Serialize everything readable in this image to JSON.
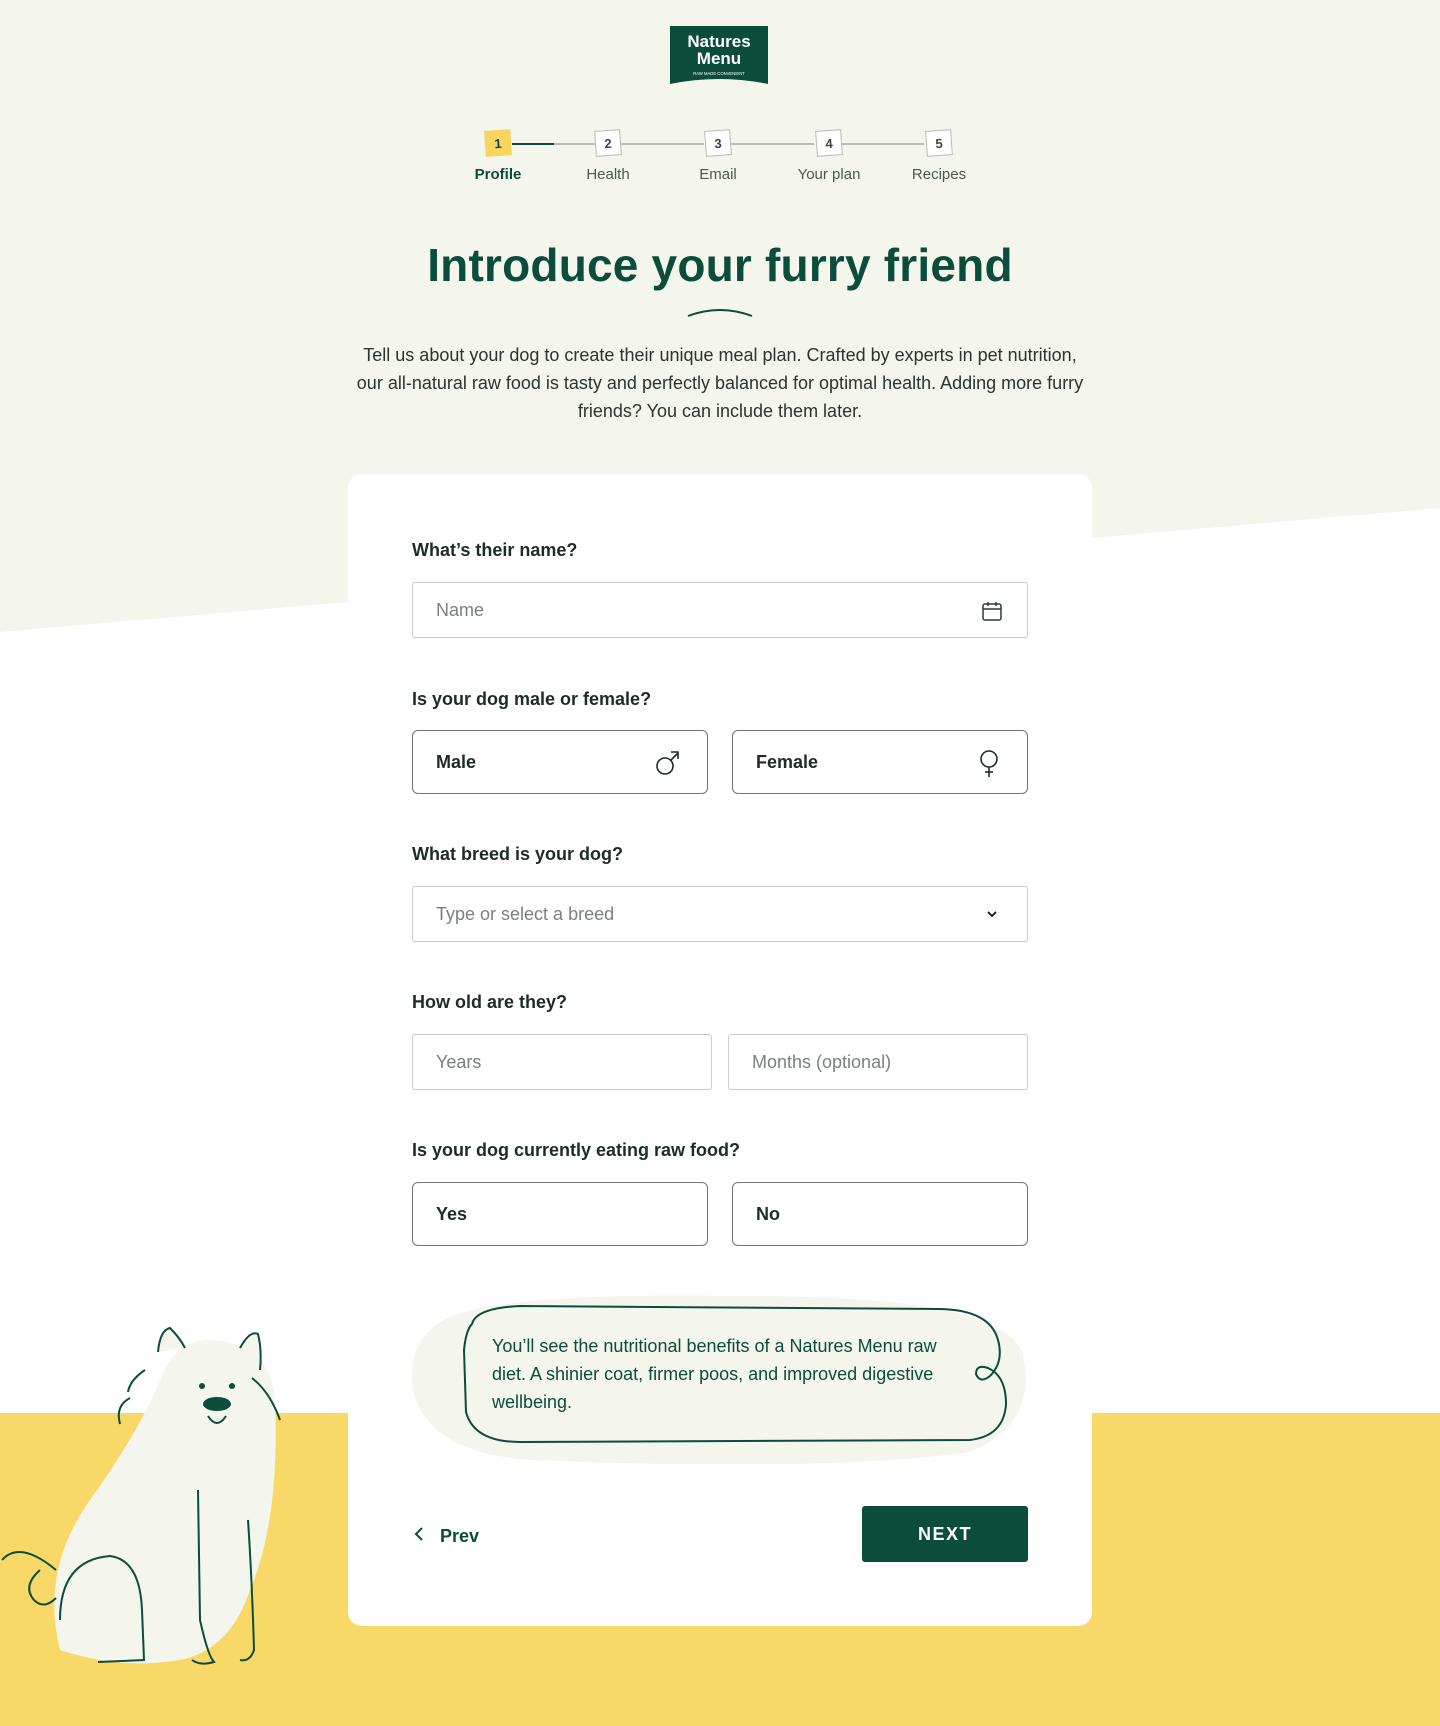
{
  "brand": {
    "logo_line1": "Natures",
    "logo_line2": "Menu",
    "logo_tagline": "RAW MADE CONVENIENT"
  },
  "stepper": {
    "steps": [
      {
        "number": "1",
        "label": "Profile",
        "state": "active"
      },
      {
        "number": "2",
        "label": "Health",
        "state": "upcoming"
      },
      {
        "number": "3",
        "label": "Email",
        "state": "upcoming"
      },
      {
        "number": "4",
        "label": "Your plan",
        "state": "upcoming"
      },
      {
        "number": "5",
        "label": "Recipes",
        "state": "upcoming"
      }
    ]
  },
  "header": {
    "title": "Introduce your furry friend",
    "intro": "Tell us about your dog to create their unique meal plan. Crafted by experts in pet nutrition, our all-natural raw food is tasty and perfectly balanced for optimal health. Adding more furry friends? You can include them later."
  },
  "form": {
    "name": {
      "question": "What’s their name?",
      "placeholder": "Name",
      "value": "",
      "icon": "calendar-icon"
    },
    "sex": {
      "question": "Is your dog male or female?",
      "options": [
        {
          "label": "Male",
          "icon": "male-symbol-icon"
        },
        {
          "label": "Female",
          "icon": "female-symbol-icon"
        }
      ]
    },
    "breed": {
      "question": "What breed is your dog?",
      "placeholder": "Type or select a breed",
      "value": "",
      "icon": "chevron-down-icon"
    },
    "age": {
      "question": "How old are they?",
      "years_placeholder": "Years",
      "months_placeholder": "Months (optional)"
    },
    "raw_food": {
      "question": "Is your dog currently eating raw food?",
      "options": [
        {
          "label": "Yes"
        },
        {
          "label": "No"
        }
      ]
    },
    "info_bubble": "You’ll see the nutritional benefits of a Natures Menu raw diet. A shinier coat, firmer poos, and improved digestive wellbeing.",
    "prev_label": "Prev",
    "next_label": "NEXT"
  },
  "colors": {
    "brand_green": "#0b4d3a",
    "cream": "#f4f5ec",
    "yellow": "#f8d968",
    "step_active": "#f6d65e"
  }
}
